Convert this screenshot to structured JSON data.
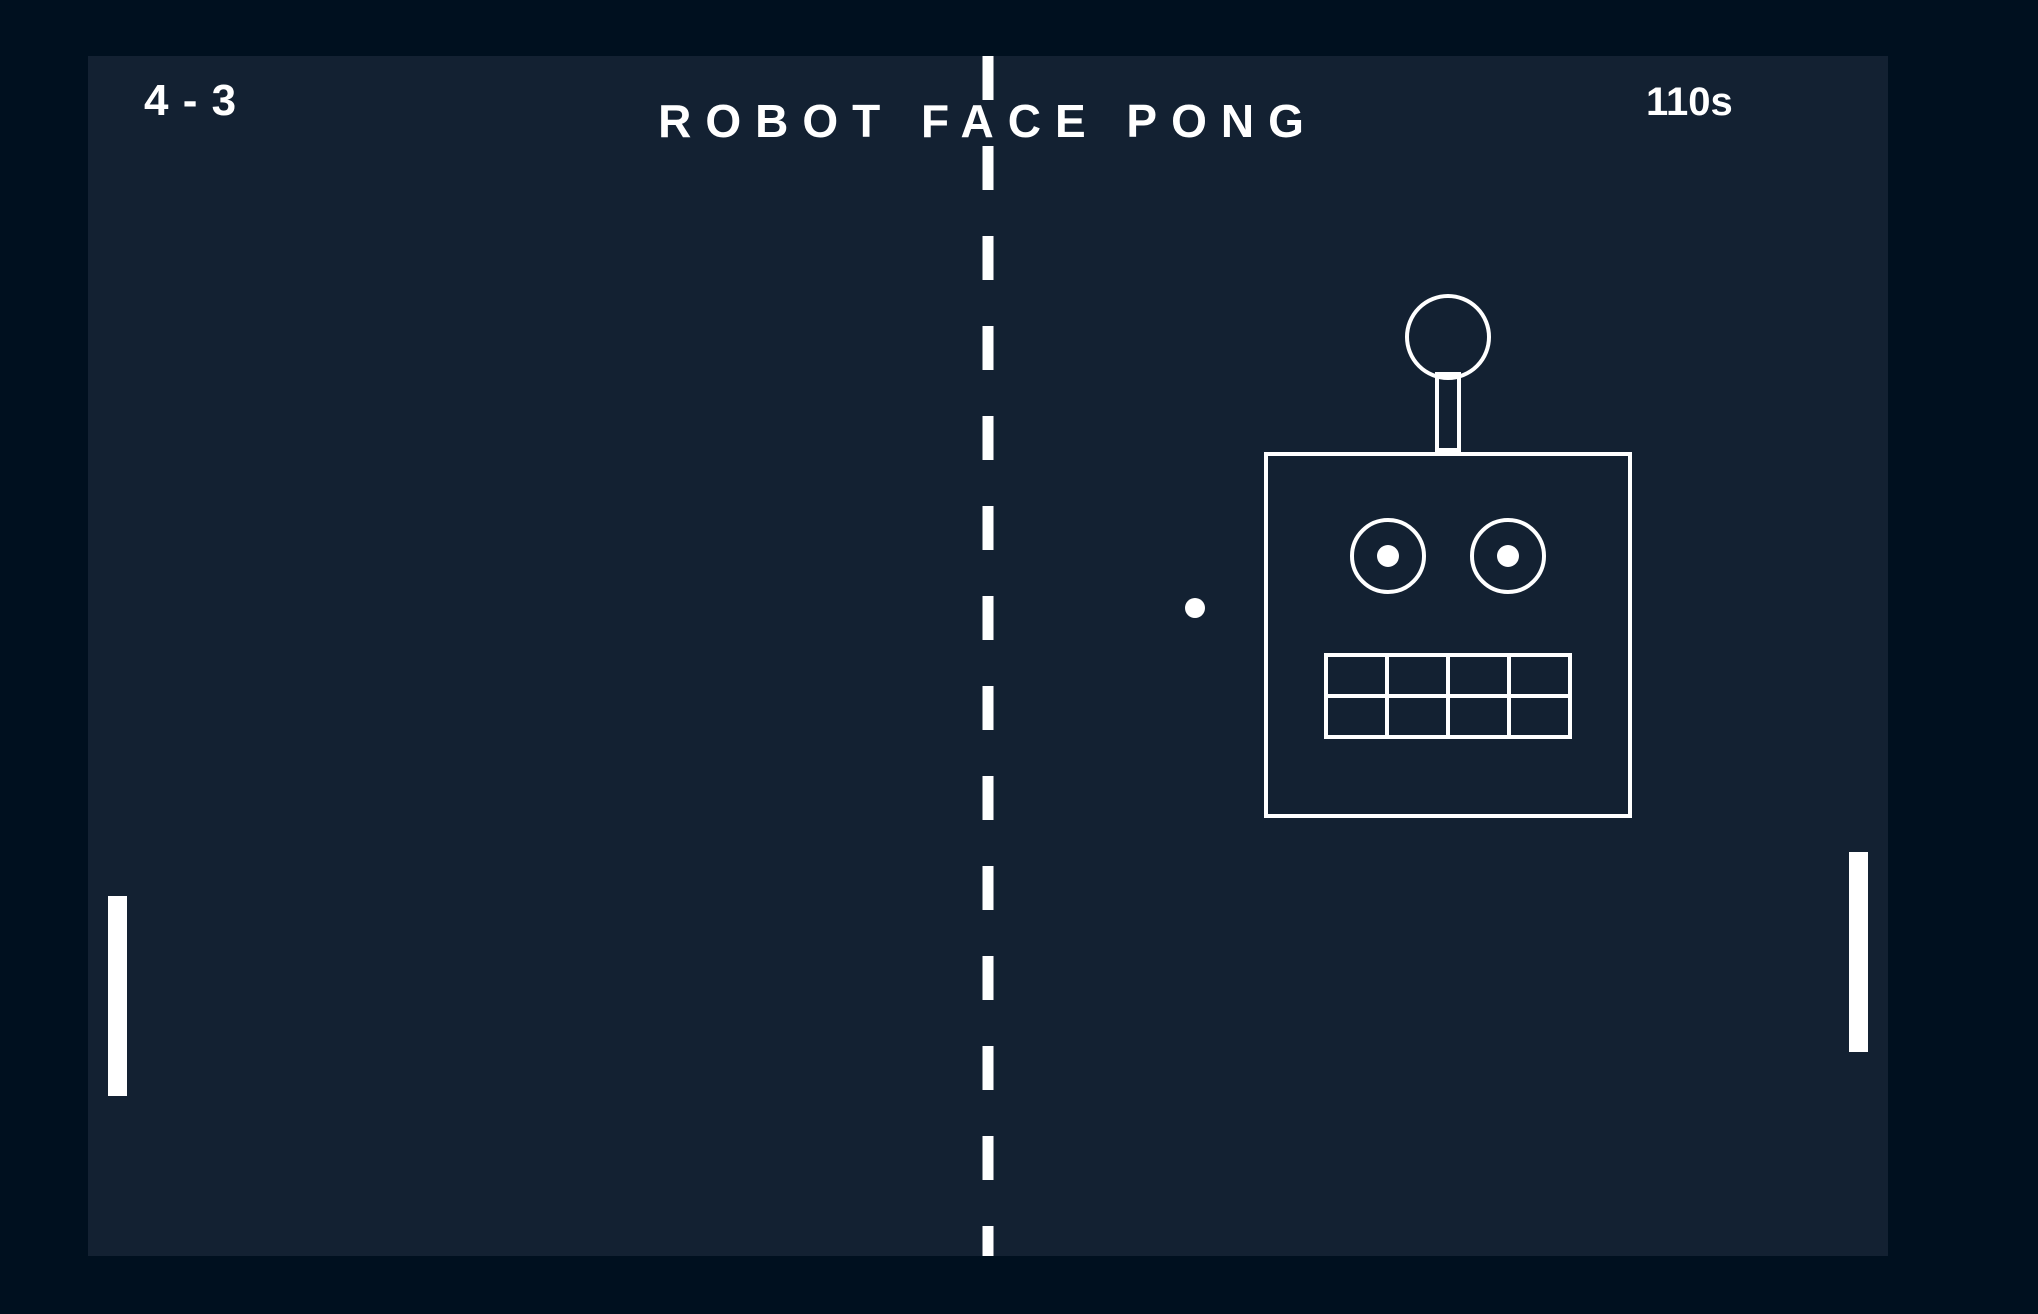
{
  "game": {
    "title": "ROBOT FACE PONG",
    "score": "4 - 3",
    "timer": "110s"
  },
  "colors": {
    "page_background": "#00101f",
    "court_background": "#132132",
    "foreground": "#ffffff"
  },
  "objects": {
    "left_paddle": "paddle",
    "right_paddle": "paddle",
    "ball": "ball",
    "center_net": "dashed-net",
    "robot_face": "robot-face"
  }
}
